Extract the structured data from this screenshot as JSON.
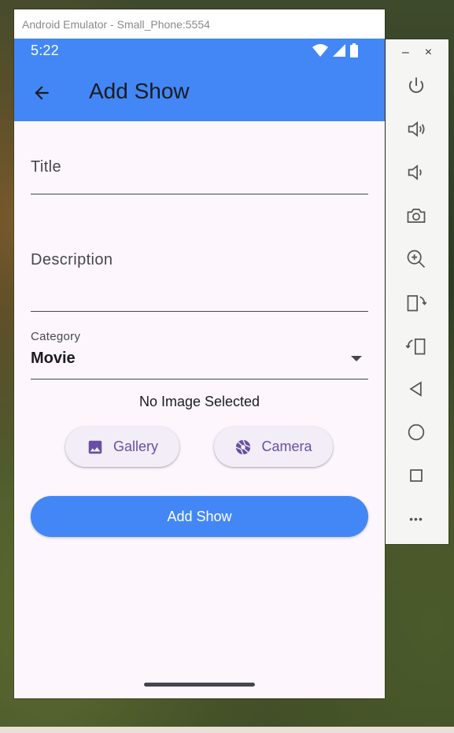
{
  "emulator": {
    "window_title": "Android Emulator - Small_Phone:5554",
    "toolbar": {
      "minimize": "–",
      "close": "×",
      "more": "•••"
    }
  },
  "status_bar": {
    "time": "5:22"
  },
  "app_bar": {
    "title": "Add Show"
  },
  "form": {
    "title_label": "Title",
    "description_label": "Description",
    "category_label": "Category",
    "category_value": "Movie",
    "image_status": "No Image Selected",
    "gallery_label": "Gallery",
    "camera_label": "Camera",
    "submit_label": "Add Show"
  },
  "colors": {
    "primary": "#4287f5",
    "surface": "#fdf7fd",
    "button_text": "#6750a4",
    "button_bg": "#f3edf7"
  }
}
